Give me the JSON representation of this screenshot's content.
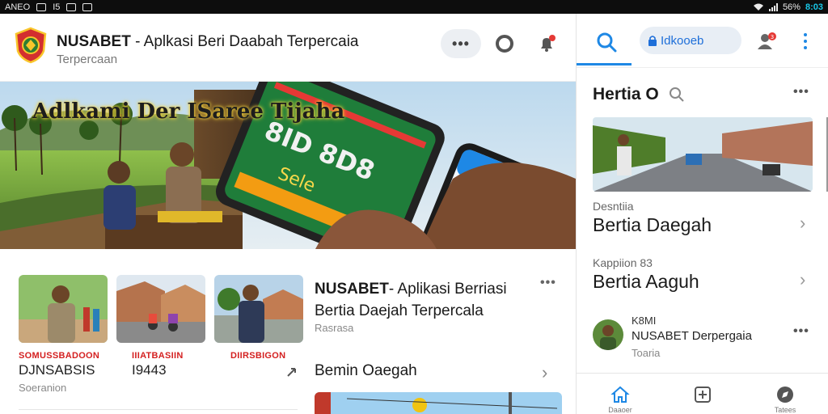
{
  "status_bar": {
    "left_text": "ANEO",
    "left_num": "I5",
    "battery": "56%",
    "time": "8:03",
    "icons": [
      "sim-icon",
      "mail-icon",
      "grid-icon",
      "wifi-icon",
      "signal-icon"
    ]
  },
  "header": {
    "brand": "NUSABET",
    "title_rest": " - Aplkasi  Beri Daabah Terpercaia",
    "subtitle": "Terpercaan",
    "more_label": "•••",
    "icons": [
      "logo-icon",
      "more-icon",
      "ring-icon",
      "bell-icon"
    ],
    "accent": "#e53935"
  },
  "hero": {
    "title": "Adlkami Der ISaree Tijaha",
    "phone_text": "8ID 8D8",
    "phone_text2": "Sele"
  },
  "thumbs": [
    {
      "label": "SOMUSSBADOON",
      "big": "DJNSABSIS",
      "small": "Soeranion"
    },
    {
      "label": "IIIATBASIIN",
      "big": "I9443",
      "small": ""
    },
    {
      "label": "DIIRSBIGON",
      "big": "",
      "small": ""
    }
  ],
  "article": {
    "brand": "NUSABET",
    "title_rest": "- Aplikasi Berriasi Bertia Daejah Terpercala",
    "meta": "Rasrasa",
    "more_label": "•••"
  },
  "section": {
    "title": "Bemin Oaegah",
    "chevron": "›"
  },
  "right_panel": {
    "search_pill": "Idkooeb",
    "badge_count": "3",
    "heading": "Hertia O",
    "more_label": "•••",
    "items": [
      {
        "category": "Desntiia",
        "title": "Bertia Daegah",
        "chevron": "›"
      },
      {
        "category": "Kappiion  83",
        "title": "Bertia Aaguh",
        "chevron": "›"
      }
    ],
    "user": {
      "line1": "K8MI",
      "line2": "NUSABET Derpergaia",
      "line3": "Toaria",
      "more_label": "•••"
    },
    "nav": [
      {
        "label": "Daaoer",
        "icon": "home-icon"
      },
      {
        "label": "",
        "icon": "plus-square-icon"
      },
      {
        "label": "Tatees",
        "icon": "compass-icon"
      }
    ],
    "accent": "#1e88e5"
  }
}
